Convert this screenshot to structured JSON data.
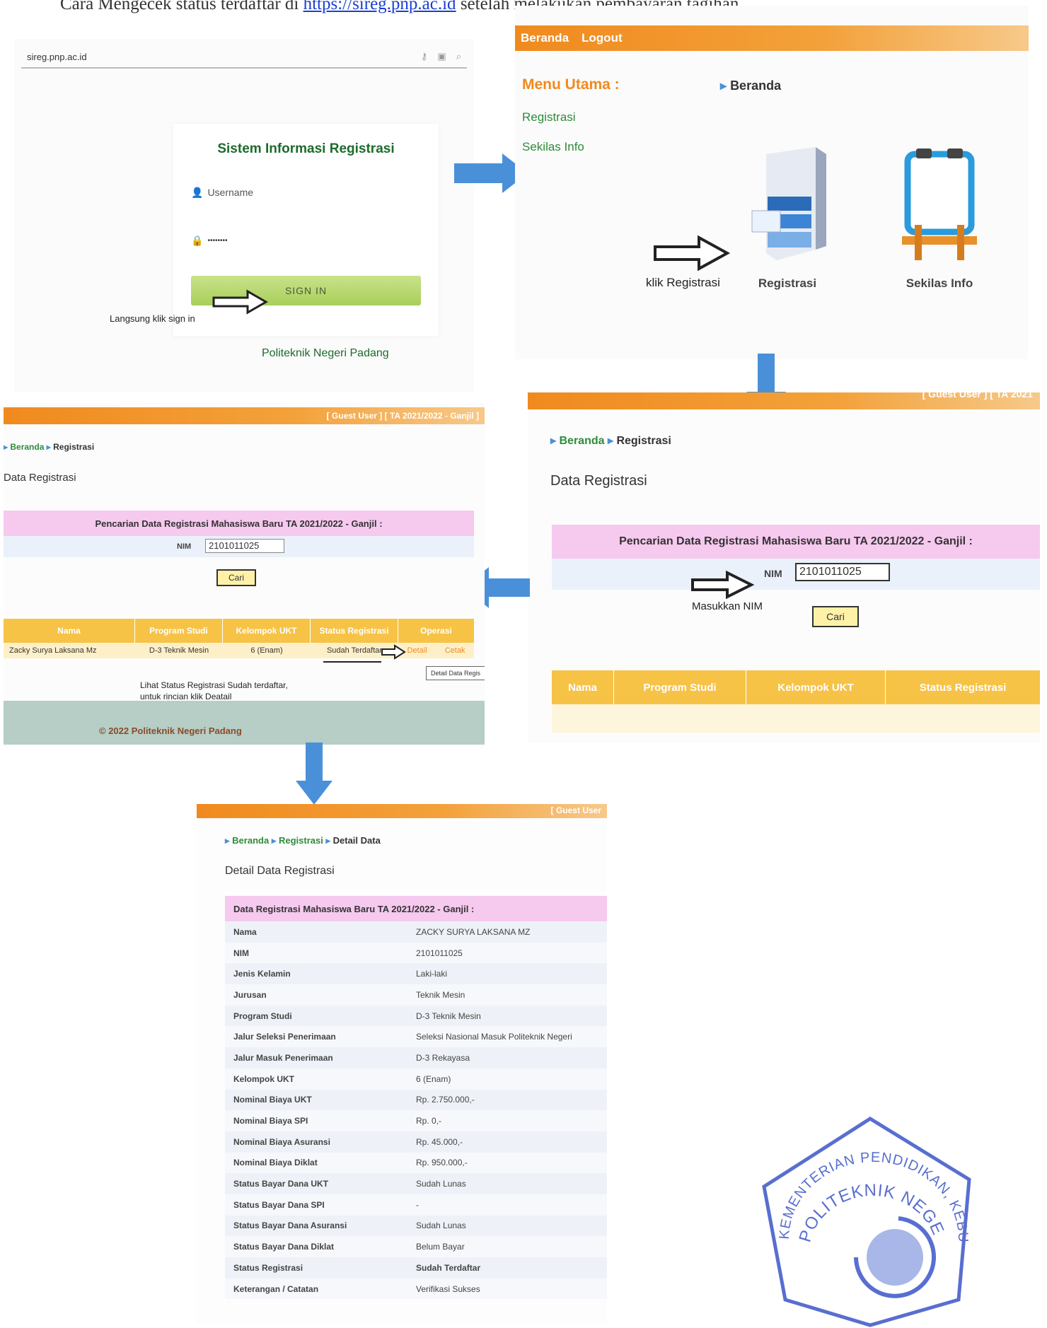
{
  "intro": {
    "text": "Cara Mengecek status terdaftar di",
    "link": "https://sireg.pnp.ac.id",
    "text_after": "setelah melakukan pembayaran tagihan"
  },
  "login": {
    "url": "sireg.pnp.ac.id",
    "title": "Sistem Informasi Registrasi",
    "username_placeholder": "Username",
    "password_value": "••••••••",
    "signin_label": "SIGN IN",
    "note": "Langsung klik sign in",
    "footer": "Politeknik Negeri Padang"
  },
  "menu": {
    "nav": [
      "Beranda",
      "Logout"
    ],
    "menu_title": "Menu Utama :",
    "breadcrumb": "Beranda",
    "links": [
      "Registrasi",
      "Sekilas Info"
    ],
    "icons": [
      {
        "label": "Registrasi",
        "icon": "cabinet-icon"
      },
      {
        "label": "Sekilas Info",
        "icon": "board-icon"
      }
    ],
    "note": "klik Registrasi"
  },
  "search_right": {
    "topbar": "[ Guest User ]   [ TA 2021",
    "breadcrumb": [
      "Beranda",
      "Registrasi"
    ],
    "page_title": "Data Registrasi",
    "search_title": "Pencarian Data Registrasi Mahasiswa Baru TA 2021/2022 - Ganjil :",
    "nim_label": "NIM",
    "nim_value": "2101011025",
    "note": "Masukkan NIM",
    "button": "Cari",
    "columns": [
      "Nama",
      "Program Studi",
      "Kelompok UKT",
      "Status Registrasi"
    ]
  },
  "search_left": {
    "topbar": "[ Guest User ]   [ TA 2021/2022 - Ganjil ]",
    "breadcrumb": [
      "Beranda",
      "Registrasi"
    ],
    "page_title": "Data Registrasi",
    "search_title": "Pencarian Data Registrasi Mahasiswa Baru TA 2021/2022 - Ganjil :",
    "nim_label": "NIM",
    "nim_value": "2101011025",
    "button": "Cari",
    "columns": [
      "Nama",
      "Program Studi",
      "Kelompok UKT",
      "Status Registrasi",
      "Operasi"
    ],
    "row": [
      "Zacky Surya Laksana Mz",
      "D-3 Teknik Mesin",
      "6 (Enam)",
      "Sudah Terdaftar"
    ],
    "ops": [
      "Detail",
      "Cetak"
    ],
    "tooltip": "Detail Data Regis",
    "note_line1": "Lihat Status Registrasi Sudah terdaftar,",
    "note_line2": "untuk rincian klik Deatail",
    "footer": "© 2022 Politeknik Negeri Padang"
  },
  "detail": {
    "topbar": "[ Guest User",
    "breadcrumb": [
      "Beranda",
      "Registrasi",
      "Detail Data"
    ],
    "page_title": "Detail Data Registrasi",
    "header": "Data Registrasi Mahasiswa Baru TA 2021/2022 - Ganjil :",
    "rows": [
      {
        "k": "Nama",
        "v": "ZACKY SURYA LAKSANA MZ"
      },
      {
        "k": "NIM",
        "v": "2101011025"
      },
      {
        "k": "Jenis Kelamin",
        "v": "Laki-laki"
      },
      {
        "k": "Jurusan",
        "v": "Teknik Mesin"
      },
      {
        "k": "Program Studi",
        "v": "D-3 Teknik Mesin"
      },
      {
        "k": "Jalur Seleksi Penerimaan",
        "v": "Seleksi Nasional Masuk Politeknik Negeri"
      },
      {
        "k": "Jalur Masuk Penerimaan",
        "v": "D-3 Rekayasa"
      },
      {
        "k": "Kelompok UKT",
        "v": "6 (Enam)"
      },
      {
        "k": "Nominal Biaya UKT",
        "v": "Rp. 2.750.000,-"
      },
      {
        "k": "Nominal Biaya SPI",
        "v": "Rp. 0,-"
      },
      {
        "k": "Nominal Biaya Asuransi",
        "v": "Rp. 45.000,-"
      },
      {
        "k": "Nominal Biaya Diklat",
        "v": "Rp. 950.000,-"
      },
      {
        "k": "Status Bayar Dana UKT",
        "v": "Sudah Lunas"
      },
      {
        "k": "Status Bayar Dana SPI",
        "v": "-"
      },
      {
        "k": "Status Bayar Dana Asuransi",
        "v": "Sudah Lunas"
      },
      {
        "k": "Status Bayar Dana Diklat",
        "v": "Belum Bayar"
      },
      {
        "k": "Status Registrasi",
        "v": "Sudah Terdaftar"
      },
      {
        "k": "Keterangan / Catatan",
        "v": "Verifikasi Sukses"
      }
    ]
  },
  "stamp": {
    "outer_text": "KEMENTERIAN PENDIDIKAN, KEBUDAYAAN, RISET, DAN TEKNOLOGI",
    "inner_text": "POLITEKNIK NEGERI PADANG",
    "color": "#3c55c8"
  }
}
